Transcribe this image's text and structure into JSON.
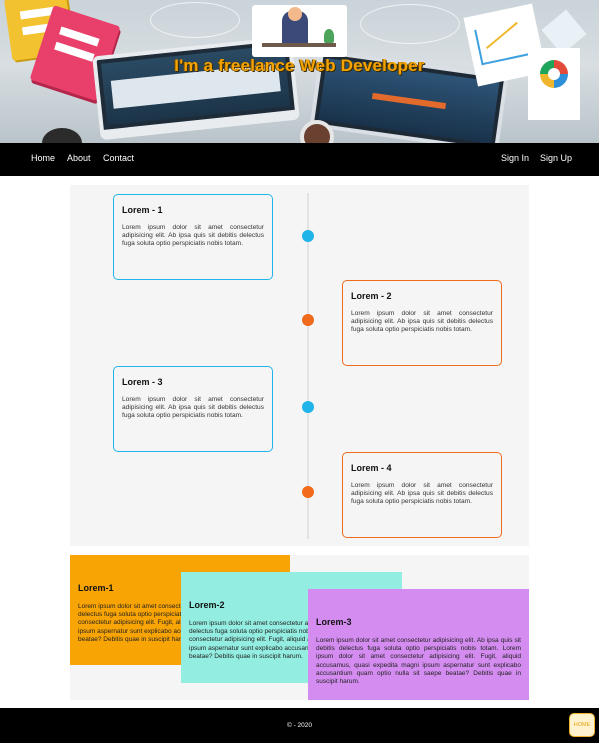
{
  "hero": {
    "title": "I'm a freelance Web Developer"
  },
  "nav": {
    "left": [
      {
        "label": "Home"
      },
      {
        "label": "About"
      },
      {
        "label": "Contact"
      }
    ],
    "right": [
      {
        "label": "Sign In"
      },
      {
        "label": "Sign Up"
      }
    ]
  },
  "timeline": {
    "items": [
      {
        "title": "Lorem - 1",
        "text": "Lorem ipsum dolor sit amet consectetur adipisicing elit. Ab ipsa quis sit debitis delectus fuga soluta optio perspiciatis nobis totam.",
        "color": "#21b4e8"
      },
      {
        "title": "Lorem - 2",
        "text": "Lorem ipsum dolor sit amet consectetur adipisicing elit. Ab ipsa quis sit debitis delectus fuga soluta optio perspiciatis nobis totam.",
        "color": "#f26a1b"
      },
      {
        "title": "Lorem - 3",
        "text": "Lorem ipsum dolor sit amet consectetur adipisicing elit. Ab ipsa quis sit debitis delectus fuga soluta optio perspiciatis nobis totam.",
        "color": "#21b4e8"
      },
      {
        "title": "Lorem - 4",
        "text": "Lorem ipsum dolor sit amet consectetur adipisicing elit. Ab ipsa quis sit debitis delectus fuga soluta optio perspiciatis nobis totam.",
        "color": "#f26a1b"
      }
    ]
  },
  "boxes": [
    {
      "title": "Lorem-1",
      "text": "Lorem ipsum dolor sit amet consectetur adipisicing elit. Ab ipsa quis sit debitis delectus fuga soluta optio perspiciatis nobis totam. Lorem ipsum dolor sit amet consectetur adipisicing elit. Fugit, aliquid accusamus, quasi expedita magni ipsum aspernatur sunt explicabo accusantium quam optio nulla sit saepe beatae? Debitis quae in suscipit harum.",
      "color": "#f9a405"
    },
    {
      "title": "Lorem-2",
      "text": "Lorem ipsum dolor sit amet consectetur adipisicing elit. Ab ipsa quis sit debitis delectus fuga soluta optio perspiciatis nobis totam. Lorem ipsum dolor sit amet consectetur adipisicing elit. Fugit, aliquid accusamus, quasi expedita magni ipsum aspernatur sunt explicabo accusantium quam optio nulla sit saepe beatae? Debitis quae in suscipit harum.",
      "color": "#93ede0"
    },
    {
      "title": "Lorem-3",
      "text": "Lorem ipsum dolor sit amet consectetur adipisicing elit. Ab ipsa quis sit debitis delectus fuga soluta optio perspiciatis nobis totam. Lorem ipsum dolor sit amet consectetur adipisicing elit. Fugit, aliquid accusamus, quasi expedita magni ipsum aspernatur sunt explicabo accusantium quam optio nulla sit saepe beatae? Debitis quae in suscipit harum.",
      "color": "#d48cf0"
    }
  ],
  "footer": {
    "copyright": "© - 2020",
    "home_button": "HOME"
  }
}
